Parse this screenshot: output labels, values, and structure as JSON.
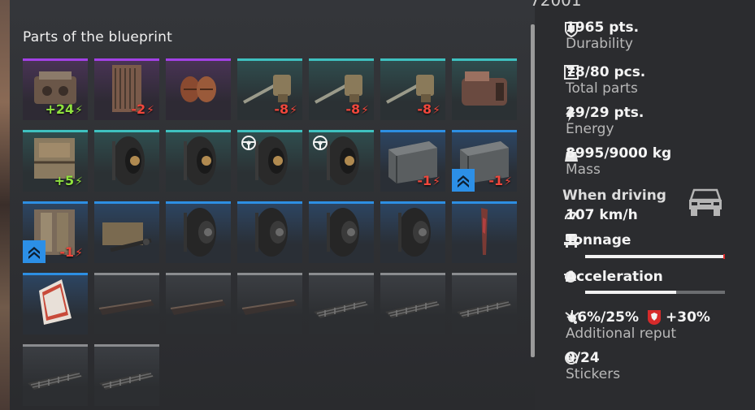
{
  "panel_title": "Parts of the blueprint",
  "top_cut_text": "72001",
  "tiles": [
    {
      "rarity": "epic",
      "kind": "engine",
      "energy": "+24"
    },
    {
      "rarity": "epic",
      "kind": "radiator",
      "energy": "-2"
    },
    {
      "rarity": "epic",
      "kind": "fans",
      "energy": ""
    },
    {
      "rarity": "special",
      "kind": "cannon",
      "energy": "-8"
    },
    {
      "rarity": "special",
      "kind": "cannon",
      "energy": "-8"
    },
    {
      "rarity": "special",
      "kind": "cannon",
      "energy": "-8"
    },
    {
      "rarity": "special",
      "kind": "module",
      "energy": ""
    },
    {
      "rarity": "special",
      "kind": "generator",
      "energy": "+5"
    },
    {
      "rarity": "special",
      "kind": "wheel",
      "energy": ""
    },
    {
      "rarity": "special",
      "kind": "wheel",
      "energy": ""
    },
    {
      "rarity": "special",
      "kind": "wheel",
      "steer": true,
      "energy": ""
    },
    {
      "rarity": "special",
      "kind": "wheel",
      "steer": true,
      "energy": ""
    },
    {
      "rarity": "rare",
      "kind": "box",
      "energy": "-1"
    },
    {
      "rarity": "rare",
      "kind": "box",
      "upgrade": true,
      "energy": "-1"
    },
    {
      "rarity": "rare",
      "kind": "cabin",
      "upgrade": true,
      "energy": "-1"
    },
    {
      "rarity": "rare",
      "kind": "frame",
      "energy": ""
    },
    {
      "rarity": "rare",
      "kind": "wheel-dark",
      "energy": ""
    },
    {
      "rarity": "rare",
      "kind": "wheel-dark",
      "energy": ""
    },
    {
      "rarity": "rare",
      "kind": "wheel-dark",
      "energy": ""
    },
    {
      "rarity": "rare",
      "kind": "wheel-dark",
      "energy": ""
    },
    {
      "rarity": "rare",
      "kind": "blade",
      "energy": ""
    },
    {
      "rarity": "rare",
      "kind": "sign",
      "energy": ""
    },
    {
      "rarity": "common",
      "kind": "beam",
      "energy": ""
    },
    {
      "rarity": "common",
      "kind": "beam",
      "energy": ""
    },
    {
      "rarity": "common",
      "kind": "beam",
      "energy": ""
    },
    {
      "rarity": "common",
      "kind": "grid",
      "energy": ""
    },
    {
      "rarity": "common",
      "kind": "grid",
      "energy": ""
    },
    {
      "rarity": "common",
      "kind": "grid",
      "energy": ""
    },
    {
      "rarity": "common",
      "kind": "grid",
      "energy": ""
    },
    {
      "rarity": "common",
      "kind": "grid",
      "energy": ""
    }
  ],
  "stats": {
    "durability": {
      "value": "1965 pts.",
      "label": "Durability",
      "icon": "shield-icon"
    },
    "parts": {
      "value": "78/80 pcs.",
      "label": "Total parts",
      "icon": "parts-icon"
    },
    "energy": {
      "value": "29/29 pts.",
      "label": "Energy",
      "icon": "energy-icon"
    },
    "mass": {
      "value": "8995/9000 kg",
      "label": "Mass",
      "icon": "weight-icon"
    }
  },
  "driving": {
    "title": "When driving",
    "speed": "107 km/h",
    "tonnage_label": "Tonnage",
    "tonnage_fraction": 0.99,
    "acceleration_label": "Acceleration",
    "acceleration_fraction": 0.65
  },
  "reput": {
    "value1": "+6%/25%",
    "value2": "+30%",
    "label": "Additional reput"
  },
  "stickers": {
    "value": "0/24",
    "label": "Stickers"
  },
  "colors": {
    "epic": "#a341e6",
    "special": "#3fc1c0",
    "rare": "#2d8fe3",
    "common": "#8a8c8f",
    "positive": "#8fe23e",
    "negative": "#f0473c"
  }
}
